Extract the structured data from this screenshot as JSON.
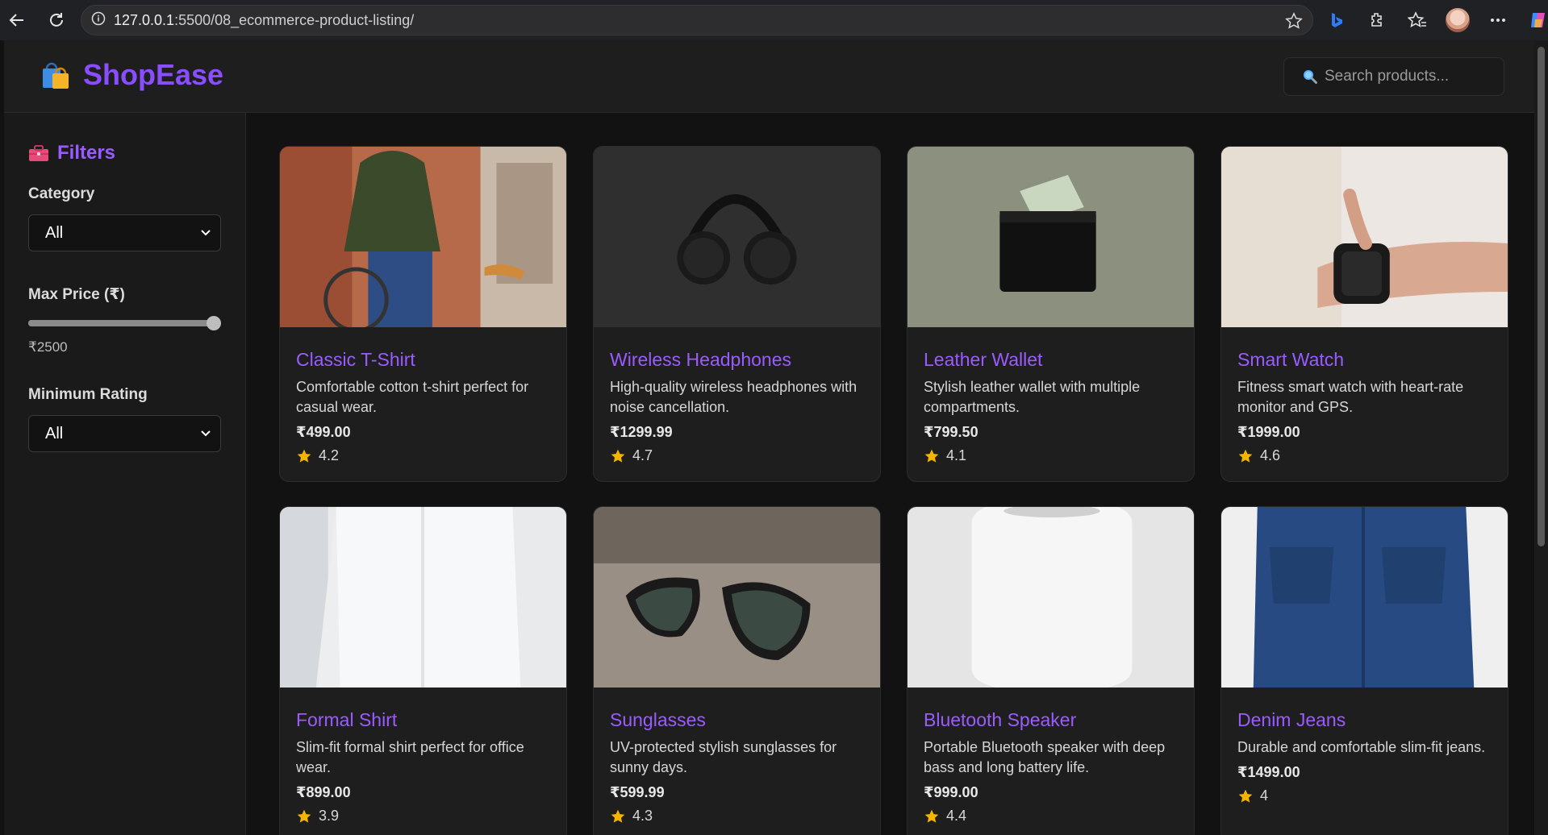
{
  "browser": {
    "url_host": "127.0.0.1",
    "url_path": ":5500/08_ecommerce-product-listing/"
  },
  "header": {
    "brand": "ShopEase",
    "brand_color": "#8a4dff",
    "search_placeholder": "Search products..."
  },
  "sidebar": {
    "title": "Filters",
    "category_label": "Category",
    "category_value": "All",
    "max_price_label": "Max Price (₹)",
    "max_price_value": "₹2500",
    "max_price_fraction": 1.0,
    "rating_label": "Minimum Rating",
    "rating_value": "All"
  },
  "products": [
    {
      "title": "Classic T-Shirt",
      "desc": "Comfortable cotton t-shirt perfect for casual wear.",
      "price": "₹499.00",
      "rating": "4.2"
    },
    {
      "title": "Wireless Headphones",
      "desc": "High-quality wireless headphones with noise cancellation.",
      "price": "₹1299.99",
      "rating": "4.7"
    },
    {
      "title": "Leather Wallet",
      "desc": "Stylish leather wallet with multiple compartments.",
      "price": "₹799.50",
      "rating": "4.1"
    },
    {
      "title": "Smart Watch",
      "desc": "Fitness smart watch with heart-rate monitor and GPS.",
      "price": "₹1999.00",
      "rating": "4.6"
    },
    {
      "title": "Formal Shirt",
      "desc": "Slim-fit formal shirt perfect for office wear.",
      "price": "₹899.00",
      "rating": "3.9"
    },
    {
      "title": "Sunglasses",
      "desc": "UV-protected stylish sunglasses for sunny days.",
      "price": "₹599.99",
      "rating": "4.3"
    },
    {
      "title": "Bluetooth Speaker",
      "desc": "Portable Bluetooth speaker with deep bass and long battery life.",
      "price": "₹999.00",
      "rating": "4.4"
    },
    {
      "title": "Denim Jeans",
      "desc": "Durable and comfortable slim-fit jeans.",
      "price": "₹1499.00",
      "rating": "4"
    }
  ]
}
